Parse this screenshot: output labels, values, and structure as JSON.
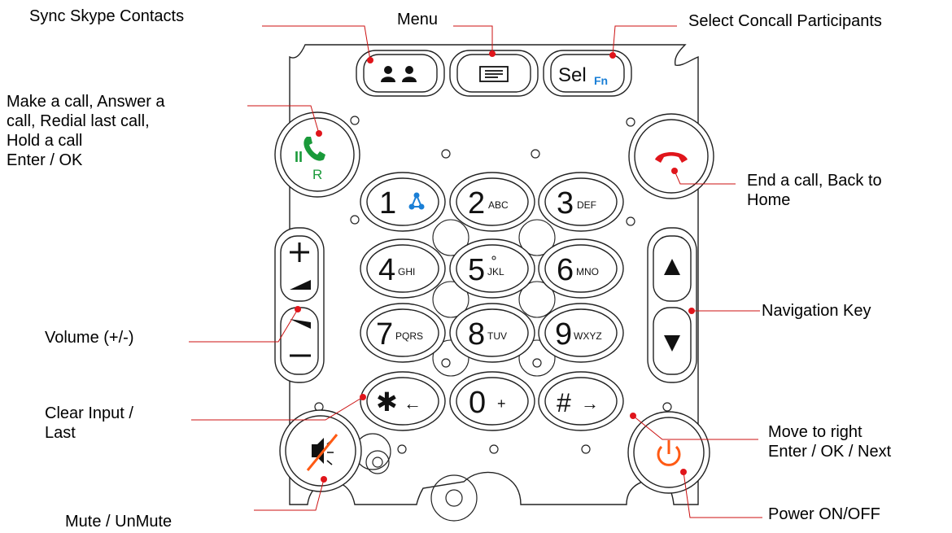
{
  "colors": {
    "outline": "#222222",
    "dot": "#e0151b",
    "leader": "#cc1111",
    "green": "#1a9a3a",
    "red": "#e0151b",
    "blue": "#1a7fd6",
    "power": "#ff5a14"
  },
  "labels": {
    "sync": "Sync Skype Contacts",
    "menu": "Menu",
    "select": "Select Concall Participants",
    "call": "Make a call, Answer a\ncall, Redial last call,\nHold a call\nEnter / OK",
    "end": "End a call, Back to\nHome",
    "nav": "Navigation Key",
    "volume": "Volume (+/-)",
    "clear": "Clear Input /\nLast",
    "move": "Move to right\nEnter / OK / Next",
    "mute": "Mute / UnMute",
    "power": "Power ON/OFF"
  },
  "keys": {
    "sel": "Sel",
    "fn": "Fn",
    "k1": "1",
    "k2": "2",
    "k2sub": "ABC",
    "k3": "3",
    "k3sub": "DEF",
    "k4": "4",
    "k4sub": "GHI",
    "k5": "5",
    "k5sub": "JKL",
    "k6": "6",
    "k6sub": "MNO",
    "k7": "7",
    "k7sub": "PQRS",
    "k8": "8",
    "k8sub": "TUV",
    "k9": "9",
    "k9sub": "WXYZ",
    "k0": "0",
    "k0sub": "+",
    "star": "✱",
    "starsub": "←",
    "hash": "#",
    "hashsub": "→",
    "hold": "II",
    "redial": "R"
  }
}
